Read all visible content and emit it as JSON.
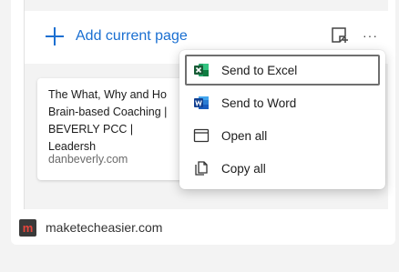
{
  "collections": {
    "add_label": "Add current page",
    "more_glyph": "···"
  },
  "page_card": {
    "title": "The What, Why and Ho\nBrain-based Coaching |\nBEVERLY PCC | Leadersh",
    "domain": "danbeverly.com"
  },
  "menu": {
    "items": [
      {
        "label": "Send to Excel",
        "icon": "excel-icon",
        "selected": true
      },
      {
        "label": "Send to Word",
        "icon": "word-icon"
      },
      {
        "label": "Open all",
        "icon": "window-icon"
      },
      {
        "label": "Copy all",
        "icon": "copy-icon"
      }
    ]
  },
  "footer": {
    "logo_letter": "m",
    "site": "maketecheasier.com"
  },
  "colors": {
    "accent": "#1a6fd1",
    "excel": "#1d7044",
    "word": "#2b5797"
  }
}
